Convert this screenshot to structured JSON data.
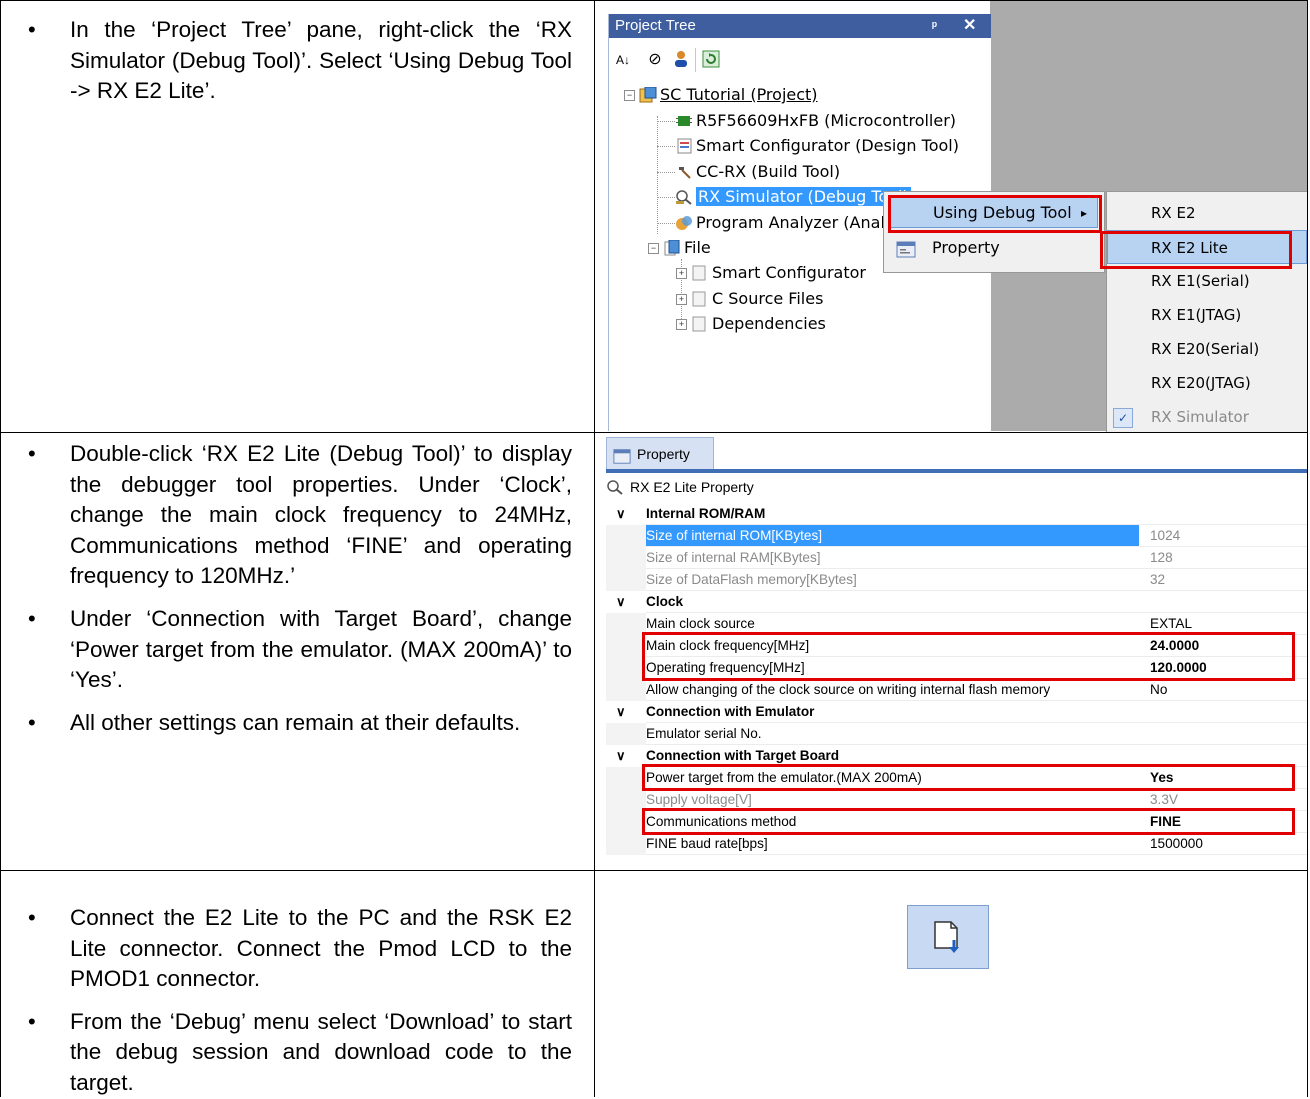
{
  "rows": [
    {
      "bullets": [
        "In the ‘Project Tree’ pane, right-click the ‘RX Simulator (Debug Tool)’. Select ‘Using Debug Tool -> RX E2 Lite’."
      ]
    },
    {
      "bullets": [
        "Double-click ‘RX E2 Lite (Debug Tool)’ to display the debugger tool properties. Under ‘Clock’, change the main clock frequency to 24MHz, Communications method ‘FINE’ and operating frequency to 120MHz.’",
        "Under ‘Connection with Target Board’, change ‘Power target from the emulator. (MAX 200mA)’ to ‘Yes’.",
        "All other settings can remain at their defaults."
      ]
    },
    {
      "bullets": [
        "Connect the E2 Lite to the PC and the RSK E2 Lite connector. Connect the Pmod LCD to the PMOD1 connector.",
        "From the ‘Debug’ menu select ‘Download’ to start the debug session and download code to the target."
      ]
    }
  ],
  "project_tree": {
    "title": "Project Tree",
    "pin": "ᵖ",
    "close": "✕",
    "toolbar_icons": [
      "sort-icon",
      "clock-icon",
      "user-icon",
      "refresh-icon"
    ],
    "items": [
      "SC Tutorial (Project)",
      "R5F56609HxFB (Microcontroller)",
      "Smart Configurator (Design Tool)",
      "CC-RX (Build Tool)",
      "RX Simulator (Debug Tool)",
      "Program Analyzer (Analyzer Tool)",
      "File",
      "Smart Configurator",
      "C Source Files",
      "Dependencies"
    ]
  },
  "context_menu": {
    "items": [
      "Using Debug Tool",
      "Property"
    ],
    "submenu_arrow": "▸"
  },
  "submenu": {
    "items": [
      "RX E2",
      "RX E2 Lite",
      "RX E1(Serial)",
      "RX E1(JTAG)",
      "RX E20(Serial)",
      "RX E20(JTAG)",
      "RX Simulator"
    ],
    "check": "✓"
  },
  "property": {
    "tab": "Property",
    "header": "RX E2 Lite Property",
    "chevron": "∨",
    "rows": [
      {
        "type": "cat",
        "name": "Internal ROM/RAM"
      },
      {
        "type": "item",
        "name": "Size of internal ROM[KBytes]",
        "value": "1024",
        "style": "selected"
      },
      {
        "type": "item",
        "name": "Size of internal RAM[KBytes]",
        "value": "128",
        "style": "gray"
      },
      {
        "type": "item",
        "name": "Size of DataFlash memory[KBytes]",
        "value": "32",
        "style": "gray"
      },
      {
        "type": "cat",
        "name": "Clock"
      },
      {
        "type": "item",
        "name": "Main clock source",
        "value": "EXTAL",
        "style": ""
      },
      {
        "type": "item",
        "name": "Main clock frequency[MHz]",
        "value": "24.0000",
        "style": "bold"
      },
      {
        "type": "item",
        "name": "Operating frequency[MHz]",
        "value": "120.0000",
        "style": "bold"
      },
      {
        "type": "item",
        "name": "Allow changing of the clock source on writing internal flash memory",
        "value": "No",
        "style": ""
      },
      {
        "type": "cat",
        "name": "Connection with Emulator"
      },
      {
        "type": "item",
        "name": "Emulator serial No.",
        "value": "",
        "style": ""
      },
      {
        "type": "cat",
        "name": "Connection with Target Board"
      },
      {
        "type": "item",
        "name": "Power target from the emulator.(MAX 200mA)",
        "value": "Yes",
        "style": "bold"
      },
      {
        "type": "item",
        "name": "Supply voltage[V]",
        "value": "3.3V",
        "style": "gray"
      },
      {
        "type": "item",
        "name": "Communications method",
        "value": "FINE",
        "style": "bold"
      },
      {
        "type": "item",
        "name": "FINE baud rate[bps]",
        "value": "1500000",
        "style": ""
      }
    ]
  },
  "download_button": {
    "icon": "download-icon"
  },
  "colors": {
    "titlebar": "#3f5e9f",
    "highlight_box": "#e00000",
    "selection": "#3399ff"
  }
}
